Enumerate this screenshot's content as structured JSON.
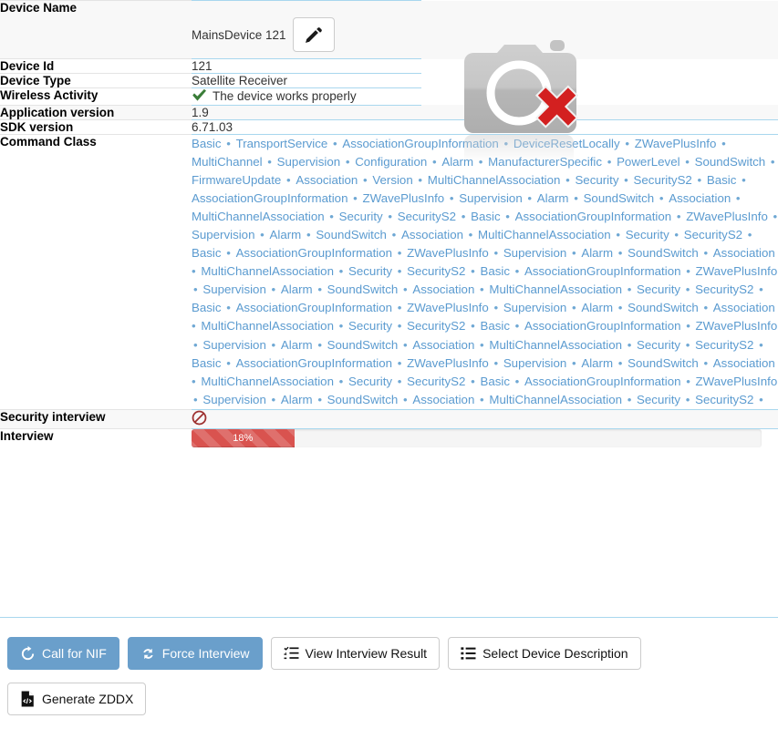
{
  "colors": {
    "accent_blue": "#6a9fcb",
    "link_blue": "#5b9bd0",
    "row_border": "#a8d7ee",
    "danger_red": "#d9534f",
    "check_green": "#3a7d38"
  },
  "rows": [
    {
      "label": "Device Name",
      "value": "MainsDevice 121"
    },
    {
      "label": "Device Id",
      "value": "121"
    },
    {
      "label": "Device Type",
      "value": "Satellite Receiver"
    },
    {
      "label": "Wireless Activity",
      "value": "The device works properly"
    },
    {
      "label": "Application version",
      "value": "1.9"
    },
    {
      "label": "SDK version",
      "value": "6.71.03"
    },
    {
      "label": "Command Class",
      "value": ""
    },
    {
      "label": "Security interview",
      "value": ""
    },
    {
      "label": "Interview",
      "value": ""
    }
  ],
  "device_name": {
    "label": "Device Name",
    "value": "MainsDevice 121",
    "edit_icon": "pencil-icon"
  },
  "device_id": {
    "label": "Device Id",
    "value": "121"
  },
  "device_type": {
    "label": "Device Type",
    "value": "Satellite Receiver"
  },
  "wireless": {
    "label": "Wireless Activity",
    "value": "The device works properly",
    "status_icon": "check-icon"
  },
  "app_version": {
    "label": "Application version",
    "value": "1.9"
  },
  "sdk_version": {
    "label": "SDK version",
    "value": "6.71.03"
  },
  "command_class": {
    "label": "Command Class",
    "separator": "•",
    "items": [
      "Basic",
      "TransportService",
      "AssociationGroupInformation",
      "DeviceResetLocally",
      "ZWavePlusInfo",
      "MultiChannel",
      "Supervision",
      "Configuration",
      "Alarm",
      "ManufacturerSpecific",
      "PowerLevel",
      "SoundSwitch",
      "FirmwareUpdate",
      "Association",
      "Version",
      "MultiChannelAssociation",
      "Security",
      "SecurityS2",
      "Basic",
      "AssociationGroupInformation",
      "ZWavePlusInfo",
      "Supervision",
      "Alarm",
      "SoundSwitch",
      "Association",
      "MultiChannelAssociation",
      "Security",
      "SecurityS2",
      "Basic",
      "AssociationGroupInformation",
      "ZWavePlusInfo",
      "Supervision",
      "Alarm",
      "SoundSwitch",
      "Association",
      "MultiChannelAssociation",
      "Security",
      "SecurityS2",
      "Basic",
      "AssociationGroupInformation",
      "ZWavePlusInfo",
      "Supervision",
      "Alarm",
      "SoundSwitch",
      "Association",
      "MultiChannelAssociation",
      "Security",
      "SecurityS2",
      "Basic",
      "AssociationGroupInformation",
      "ZWavePlusInfo",
      "Supervision",
      "Alarm",
      "SoundSwitch",
      "Association",
      "MultiChannelAssociation",
      "Security",
      "SecurityS2",
      "Basic",
      "AssociationGroupInformation",
      "ZWavePlusInfo",
      "Supervision",
      "Alarm",
      "SoundSwitch",
      "Association",
      "MultiChannelAssociation",
      "Security",
      "SecurityS2",
      "Basic",
      "AssociationGroupInformation",
      "ZWavePlusInfo",
      "Supervision",
      "Alarm",
      "SoundSwitch",
      "Association",
      "MultiChannelAssociation",
      "Security",
      "SecurityS2",
      "Basic",
      "AssociationGroupInformation",
      "ZWavePlusInfo",
      "Supervision",
      "Alarm",
      "SoundSwitch",
      "Association",
      "MultiChannelAssociation",
      "Security",
      "SecurityS2",
      "Basic",
      "AssociationGroupInformation",
      "ZWavePlusInfo",
      "Supervision",
      "Alarm",
      "SoundSwitch",
      "Association",
      "MultiChannelAssociation",
      "Security",
      "SecurityS2"
    ]
  },
  "security_interview": {
    "label": "Security interview",
    "status_icon": "forbidden-icon"
  },
  "interview": {
    "label": "Interview",
    "percent_text": "18%",
    "percent_value": 18
  },
  "thumbnail": {
    "icon": "broken-image-icon"
  },
  "actions": {
    "row1": [
      {
        "label": "Call for NIF",
        "icon": "refresh-cw-icon",
        "style": "primary"
      },
      {
        "label": "Force Interview",
        "icon": "refresh-sync-icon",
        "style": "primary"
      },
      {
        "label": "View Interview Result",
        "icon": "list-check-icon",
        "style": "default"
      },
      {
        "label": "Select Device Description",
        "icon": "list-ul-icon",
        "style": "default"
      }
    ],
    "row2": [
      {
        "label": "Generate ZDDX",
        "icon": "file-code-icon",
        "style": "default"
      }
    ]
  }
}
